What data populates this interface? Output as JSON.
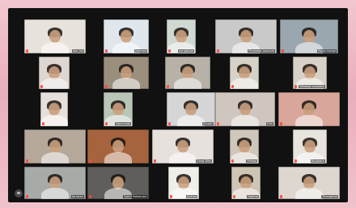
{
  "app": {
    "title": ""
  },
  "tiles": [
    {
      "name": "lam_tet",
      "bg": "#e8e2dc"
    },
    {
      "name": "jammpa",
      "bg": "#dfe6ec"
    },
    {
      "name": "kungtatae",
      "bg": "#cfd8d1"
    },
    {
      "name": "Phornwat Jalurlom",
      "bg": "#c9c9c9"
    },
    {
      "name": "Wasin Kanjai",
      "bg": "#9aa7ae"
    },
    {
      "name": "",
      "bg": "#ddd6d1"
    },
    {
      "name": "",
      "bg": "#9a8e7d"
    },
    {
      "name": "",
      "bg": "#b7b1a7"
    },
    {
      "name": "",
      "bg": "#d7d2c8"
    },
    {
      "name": "Wirawat Lonkaew",
      "bg": "#d8d1c7"
    },
    {
      "name": "",
      "bg": "#e6dfdb"
    },
    {
      "name": "Narinchak",
      "bg": "#b9c6b7"
    },
    {
      "name": "Cluster",
      "bg": "#d6d6d6"
    },
    {
      "name": "Ellie",
      "bg": "#cfc7bf"
    },
    {
      "name": "",
      "bg": "#d8a69a"
    },
    {
      "name": "",
      "bg": "#b5a79a"
    },
    {
      "name": "",
      "bg": "#a5643d"
    },
    {
      "name": "Gong Wan",
      "bg": "#e6e1dd"
    },
    {
      "name": "Palapa",
      "bg": "#cfc7bc"
    },
    {
      "name": "Busakorn",
      "bg": "#e7e3dd"
    },
    {
      "name": "Jarawan",
      "bg": "#a7aba8"
    },
    {
      "name": "Gotai Yammuan",
      "bg": "#605e5b"
    },
    {
      "name": "Apinya",
      "bg": "#f0eeea"
    },
    {
      "name": "Naphat",
      "bg": "#cfc5b5"
    },
    {
      "name": "Thanaphat",
      "bg": "#ddd7cf"
    }
  ],
  "colors": {
    "screen_bg": "#111111",
    "outer_bg": "#f0c2cb"
  },
  "icons": {
    "chat": "chat-bubble-icon",
    "mic": "mic-muted-icon"
  }
}
